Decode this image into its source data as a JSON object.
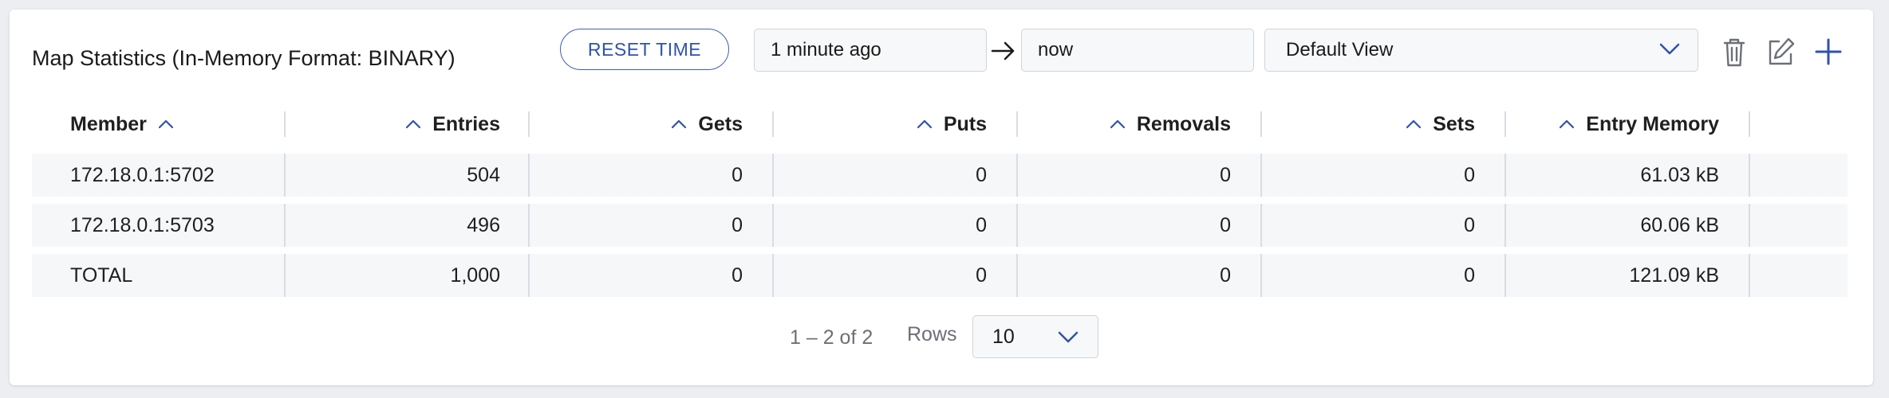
{
  "panel": {
    "title": "Map Statistics (In-Memory Format: BINARY)"
  },
  "toolbar": {
    "reset_label": "RESET TIME",
    "from_value": "1 minute ago",
    "to_value": "now",
    "view_value": "Default View",
    "icons": [
      "arrow-right-icon",
      "chevron-down-icon",
      "trash-icon",
      "edit-icon",
      "plus-icon"
    ]
  },
  "table": {
    "headers": [
      "Member",
      "Entries",
      "Gets",
      "Puts",
      "Removals",
      "Sets",
      "Entry Memory"
    ],
    "rows": [
      [
        "172.18.0.1:5702",
        "504",
        "0",
        "0",
        "0",
        "0",
        "61.03 kB"
      ],
      [
        "172.18.0.1:5703",
        "496",
        "0",
        "0",
        "0",
        "0",
        "60.06 kB"
      ],
      [
        "TOTAL",
        "1,000",
        "0",
        "0",
        "0",
        "0",
        "121.09 kB"
      ]
    ]
  },
  "pagination": {
    "range": "1 – 2 of 2",
    "rows_label": "Rows",
    "rows_value": "10"
  },
  "colors": {
    "accent": "#2f52ad",
    "row_bg": "#f6f7f8",
    "separator": "#d9dce1"
  }
}
